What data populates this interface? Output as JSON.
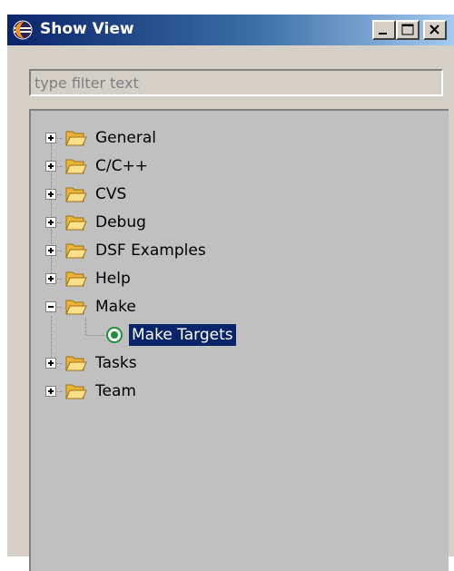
{
  "window": {
    "title": "Show View",
    "icon": "eclipse-icon",
    "controls": [
      "minimize-icon",
      "maximize-icon",
      "close-icon"
    ]
  },
  "filter": {
    "placeholder": "type filter text",
    "value": ""
  },
  "tree": {
    "categories": [
      {
        "label": "General",
        "expanded": false
      },
      {
        "label": "C/C++",
        "expanded": false
      },
      {
        "label": "CVS",
        "expanded": false
      },
      {
        "label": "Debug",
        "expanded": false
      },
      {
        "label": "DSF Examples",
        "expanded": false
      },
      {
        "label": "Help",
        "expanded": false
      },
      {
        "label": "Make",
        "expanded": true,
        "children": [
          {
            "label": "Make Targets",
            "selected": true,
            "icon": "make-targets-icon"
          }
        ]
      },
      {
        "label": "Tasks",
        "expanded": false
      },
      {
        "label": "Team",
        "expanded": false
      }
    ]
  },
  "colors": {
    "title_bar_start": "#0a246a",
    "title_bar_end": "#a6caf0",
    "selection": "#0a246a",
    "tree_background": "#c0c0c0"
  }
}
